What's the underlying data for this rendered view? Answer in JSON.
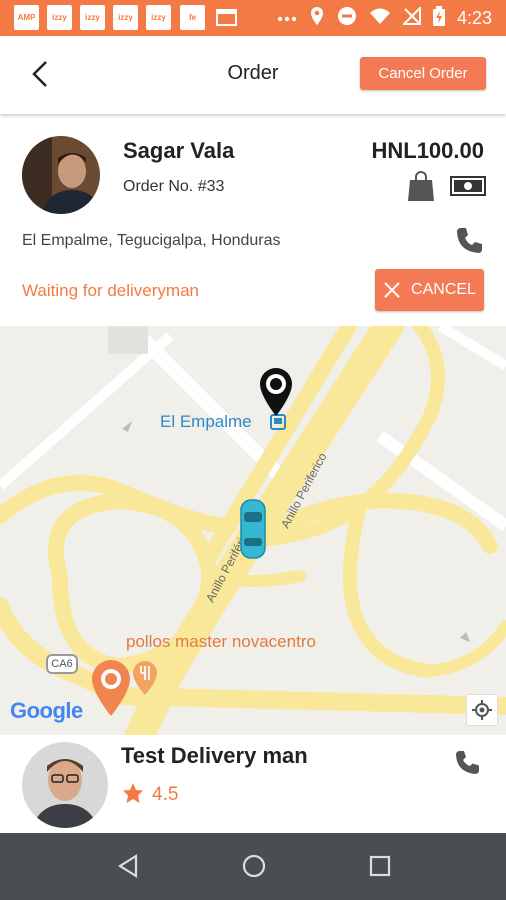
{
  "status_bar": {
    "apps": [
      "AMP",
      "izzy",
      "izzy",
      "izzy",
      "izzy",
      "fe"
    ],
    "time": "4:23"
  },
  "header": {
    "title": "Order",
    "cancel_order_label": "Cancel Order"
  },
  "order": {
    "customer_name": "Sagar Vala",
    "order_number": "Order No. #33",
    "price": "HNL100.00",
    "address": "El Empalme, Tegucigalpa, Honduras",
    "status": "Waiting for deliveryman",
    "cancel_label": "CANCEL"
  },
  "map": {
    "place_label": "El Empalme",
    "restaurant_label": "pollos master novacentro",
    "road_label_1": "Anillo Periferico",
    "road_label_2": "Anillo Periferico",
    "road_label_3": "Anillo Periférico",
    "highway_shield": "CA6",
    "attribution": "Google"
  },
  "driver": {
    "name": "Test Delivery man",
    "rating": "4.5"
  },
  "colors": {
    "accent": "#f47a45",
    "road": "#f9e89a",
    "map_bg": "#f1efea",
    "car": "#35b8d4",
    "place_blue": "#2b8bc6"
  },
  "icons": {
    "back": "chevron-left-icon",
    "bag": "shopping-bag-icon",
    "cash": "cash-icon",
    "phone": "phone-icon",
    "close": "close-icon",
    "pin": "map-pin-icon",
    "car": "car-icon",
    "star": "star-icon",
    "locate": "my-location-icon"
  }
}
